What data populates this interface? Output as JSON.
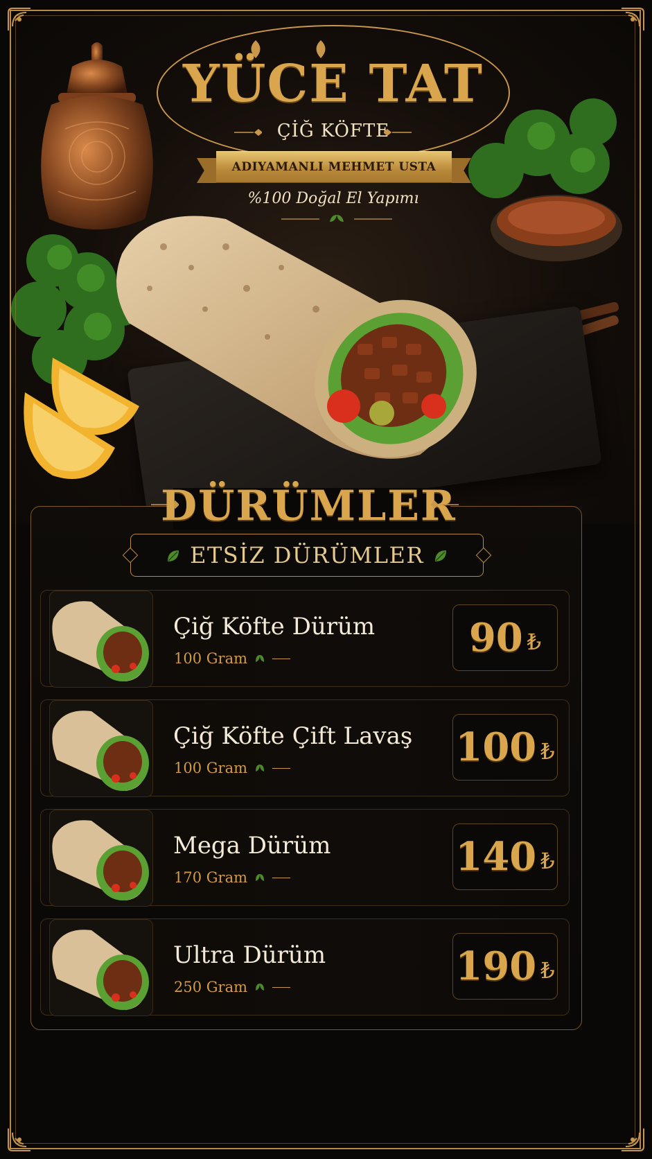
{
  "header": {
    "brand": "YÜCE TAT",
    "subtitle": "ÇİĞ KÖFTE",
    "ribbon": "ADIYAMANLI MEHMET USTA",
    "tagline": "%100 Doğal El Yapımı"
  },
  "menu": {
    "section_title": "DÜRÜMLER",
    "category": "ETSİZ DÜRÜMLER",
    "currency": "₺",
    "items": [
      {
        "name": "Çiğ Köfte Dürüm",
        "weight": "100 Gram",
        "price": "90"
      },
      {
        "name": "Çiğ Köfte Çift Lavaş",
        "weight": "100 Gram",
        "price": "100"
      },
      {
        "name": "Mega Dürüm",
        "weight": "170 Gram",
        "price": "140"
      },
      {
        "name": "Ultra Dürüm",
        "weight": "250 Gram",
        "price": "190"
      }
    ]
  },
  "colors": {
    "gold": "#d9a64e",
    "background": "#0a0806",
    "text": "#f4ead8",
    "leaf_green": "#4e8a2a"
  },
  "icons": [
    "leaf-icon",
    "corner-ornament-icon",
    "flourish-icon"
  ]
}
